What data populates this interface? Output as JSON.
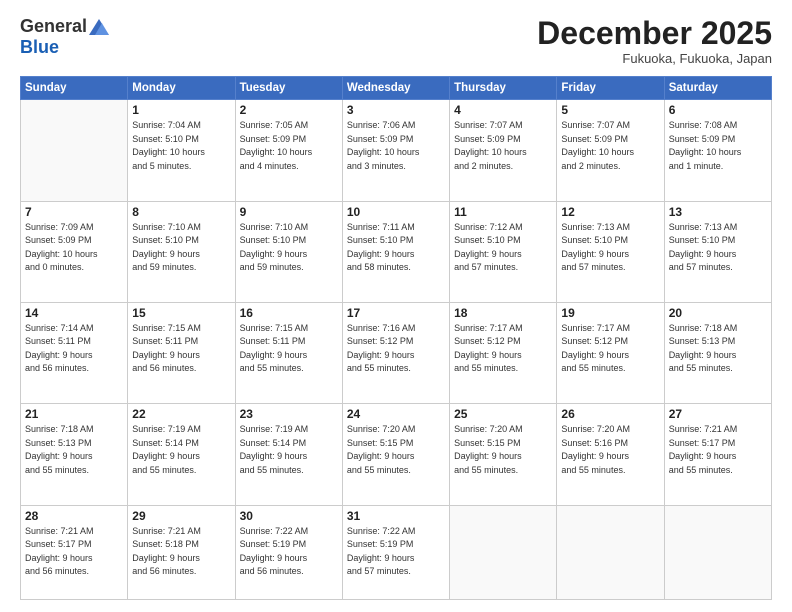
{
  "logo": {
    "general": "General",
    "blue": "Blue"
  },
  "header": {
    "month": "December 2025",
    "location": "Fukuoka, Fukuoka, Japan"
  },
  "weekdays": [
    "Sunday",
    "Monday",
    "Tuesday",
    "Wednesday",
    "Thursday",
    "Friday",
    "Saturday"
  ],
  "weeks": [
    [
      {
        "day": "",
        "info": ""
      },
      {
        "day": "1",
        "info": "Sunrise: 7:04 AM\nSunset: 5:10 PM\nDaylight: 10 hours\nand 5 minutes."
      },
      {
        "day": "2",
        "info": "Sunrise: 7:05 AM\nSunset: 5:09 PM\nDaylight: 10 hours\nand 4 minutes."
      },
      {
        "day": "3",
        "info": "Sunrise: 7:06 AM\nSunset: 5:09 PM\nDaylight: 10 hours\nand 3 minutes."
      },
      {
        "day": "4",
        "info": "Sunrise: 7:07 AM\nSunset: 5:09 PM\nDaylight: 10 hours\nand 2 minutes."
      },
      {
        "day": "5",
        "info": "Sunrise: 7:07 AM\nSunset: 5:09 PM\nDaylight: 10 hours\nand 2 minutes."
      },
      {
        "day": "6",
        "info": "Sunrise: 7:08 AM\nSunset: 5:09 PM\nDaylight: 10 hours\nand 1 minute."
      }
    ],
    [
      {
        "day": "7",
        "info": "Sunrise: 7:09 AM\nSunset: 5:09 PM\nDaylight: 10 hours\nand 0 minutes."
      },
      {
        "day": "8",
        "info": "Sunrise: 7:10 AM\nSunset: 5:10 PM\nDaylight: 9 hours\nand 59 minutes."
      },
      {
        "day": "9",
        "info": "Sunrise: 7:10 AM\nSunset: 5:10 PM\nDaylight: 9 hours\nand 59 minutes."
      },
      {
        "day": "10",
        "info": "Sunrise: 7:11 AM\nSunset: 5:10 PM\nDaylight: 9 hours\nand 58 minutes."
      },
      {
        "day": "11",
        "info": "Sunrise: 7:12 AM\nSunset: 5:10 PM\nDaylight: 9 hours\nand 57 minutes."
      },
      {
        "day": "12",
        "info": "Sunrise: 7:13 AM\nSunset: 5:10 PM\nDaylight: 9 hours\nand 57 minutes."
      },
      {
        "day": "13",
        "info": "Sunrise: 7:13 AM\nSunset: 5:10 PM\nDaylight: 9 hours\nand 57 minutes."
      }
    ],
    [
      {
        "day": "14",
        "info": "Sunrise: 7:14 AM\nSunset: 5:11 PM\nDaylight: 9 hours\nand 56 minutes."
      },
      {
        "day": "15",
        "info": "Sunrise: 7:15 AM\nSunset: 5:11 PM\nDaylight: 9 hours\nand 56 minutes."
      },
      {
        "day": "16",
        "info": "Sunrise: 7:15 AM\nSunset: 5:11 PM\nDaylight: 9 hours\nand 55 minutes."
      },
      {
        "day": "17",
        "info": "Sunrise: 7:16 AM\nSunset: 5:12 PM\nDaylight: 9 hours\nand 55 minutes."
      },
      {
        "day": "18",
        "info": "Sunrise: 7:17 AM\nSunset: 5:12 PM\nDaylight: 9 hours\nand 55 minutes."
      },
      {
        "day": "19",
        "info": "Sunrise: 7:17 AM\nSunset: 5:12 PM\nDaylight: 9 hours\nand 55 minutes."
      },
      {
        "day": "20",
        "info": "Sunrise: 7:18 AM\nSunset: 5:13 PM\nDaylight: 9 hours\nand 55 minutes."
      }
    ],
    [
      {
        "day": "21",
        "info": "Sunrise: 7:18 AM\nSunset: 5:13 PM\nDaylight: 9 hours\nand 55 minutes."
      },
      {
        "day": "22",
        "info": "Sunrise: 7:19 AM\nSunset: 5:14 PM\nDaylight: 9 hours\nand 55 minutes."
      },
      {
        "day": "23",
        "info": "Sunrise: 7:19 AM\nSunset: 5:14 PM\nDaylight: 9 hours\nand 55 minutes."
      },
      {
        "day": "24",
        "info": "Sunrise: 7:20 AM\nSunset: 5:15 PM\nDaylight: 9 hours\nand 55 minutes."
      },
      {
        "day": "25",
        "info": "Sunrise: 7:20 AM\nSunset: 5:15 PM\nDaylight: 9 hours\nand 55 minutes."
      },
      {
        "day": "26",
        "info": "Sunrise: 7:20 AM\nSunset: 5:16 PM\nDaylight: 9 hours\nand 55 minutes."
      },
      {
        "day": "27",
        "info": "Sunrise: 7:21 AM\nSunset: 5:17 PM\nDaylight: 9 hours\nand 55 minutes."
      }
    ],
    [
      {
        "day": "28",
        "info": "Sunrise: 7:21 AM\nSunset: 5:17 PM\nDaylight: 9 hours\nand 56 minutes."
      },
      {
        "day": "29",
        "info": "Sunrise: 7:21 AM\nSunset: 5:18 PM\nDaylight: 9 hours\nand 56 minutes."
      },
      {
        "day": "30",
        "info": "Sunrise: 7:22 AM\nSunset: 5:19 PM\nDaylight: 9 hours\nand 56 minutes."
      },
      {
        "day": "31",
        "info": "Sunrise: 7:22 AM\nSunset: 5:19 PM\nDaylight: 9 hours\nand 57 minutes."
      },
      {
        "day": "",
        "info": ""
      },
      {
        "day": "",
        "info": ""
      },
      {
        "day": "",
        "info": ""
      }
    ]
  ]
}
